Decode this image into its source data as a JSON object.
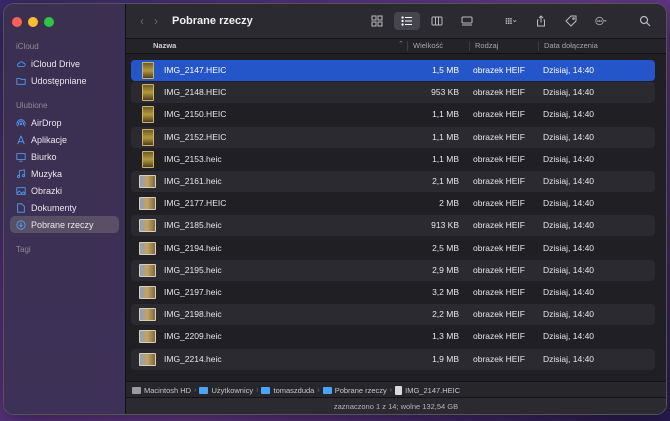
{
  "window": {
    "title": "Pobrane rzeczy"
  },
  "sidebar": {
    "sections": [
      {
        "title": "iCloud",
        "items": [
          {
            "label": "iCloud Drive",
            "icon": "cloud-icon"
          },
          {
            "label": "Udostępniane",
            "icon": "shared-folder-icon"
          }
        ]
      },
      {
        "title": "Ulubione",
        "items": [
          {
            "label": "AirDrop",
            "icon": "airdrop-icon"
          },
          {
            "label": "Aplikacje",
            "icon": "applications-icon"
          },
          {
            "label": "Biurko",
            "icon": "desktop-icon"
          },
          {
            "label": "Muzyka",
            "icon": "music-icon"
          },
          {
            "label": "Obrazki",
            "icon": "pictures-icon"
          },
          {
            "label": "Dokumenty",
            "icon": "documents-icon"
          },
          {
            "label": "Pobrane rzeczy",
            "icon": "downloads-icon",
            "selected": true
          }
        ]
      },
      {
        "title": "Tagi",
        "items": []
      }
    ]
  },
  "columns": {
    "name": "Nazwa",
    "size": "Wielkość",
    "kind": "Rodzaj",
    "date": "Data dołączenia"
  },
  "files": [
    {
      "name": "IMG_2147.HEIC",
      "size": "1,5 MB",
      "kind": "obrazek HEIF",
      "date": "Dzisiaj, 14:40",
      "orientation": "portrait",
      "selected": true
    },
    {
      "name": "IMG_2148.HEIC",
      "size": "953 KB",
      "kind": "obrazek HEIF",
      "date": "Dzisiaj, 14:40",
      "orientation": "portrait"
    },
    {
      "name": "IMG_2150.HEIC",
      "size": "1,1 MB",
      "kind": "obrazek HEIF",
      "date": "Dzisiaj, 14:40",
      "orientation": "portrait"
    },
    {
      "name": "IMG_2152.HEIC",
      "size": "1,1 MB",
      "kind": "obrazek HEIF",
      "date": "Dzisiaj, 14:40",
      "orientation": "portrait"
    },
    {
      "name": "IMG_2153.heic",
      "size": "1,1 MB",
      "kind": "obrazek HEIF",
      "date": "Dzisiaj, 14:40",
      "orientation": "portrait"
    },
    {
      "name": "IMG_2161.heic",
      "size": "2,1 MB",
      "kind": "obrazek HEIF",
      "date": "Dzisiaj, 14:40",
      "orientation": "landscape"
    },
    {
      "name": "IMG_2177.HEIC",
      "size": "2 MB",
      "kind": "obrazek HEIF",
      "date": "Dzisiaj, 14:40",
      "orientation": "landscape"
    },
    {
      "name": "IMG_2185.heic",
      "size": "913 KB",
      "kind": "obrazek HEIF",
      "date": "Dzisiaj, 14:40",
      "orientation": "landscape"
    },
    {
      "name": "IMG_2194.heic",
      "size": "2,5 MB",
      "kind": "obrazek HEIF",
      "date": "Dzisiaj, 14:40",
      "orientation": "landscape"
    },
    {
      "name": "IMG_2195.heic",
      "size": "2,9 MB",
      "kind": "obrazek HEIF",
      "date": "Dzisiaj, 14:40",
      "orientation": "landscape"
    },
    {
      "name": "IMG_2197.heic",
      "size": "3,2 MB",
      "kind": "obrazek HEIF",
      "date": "Dzisiaj, 14:40",
      "orientation": "landscape"
    },
    {
      "name": "IMG_2198.heic",
      "size": "2,2 MB",
      "kind": "obrazek HEIF",
      "date": "Dzisiaj, 14:40",
      "orientation": "landscape"
    },
    {
      "name": "IMG_2209.heic",
      "size": "1,3 MB",
      "kind": "obrazek HEIF",
      "date": "Dzisiaj, 14:40",
      "orientation": "landscape"
    },
    {
      "name": "IMG_2214.heic",
      "size": "1,9 MB",
      "kind": "obrazek HEIF",
      "date": "Dzisiaj, 14:40",
      "orientation": "landscape"
    }
  ],
  "pathbar": [
    {
      "label": "Macintosh HD",
      "icon": "disk-icon"
    },
    {
      "label": "Użytkownicy",
      "icon": "folder-icon"
    },
    {
      "label": "tomaszduda",
      "icon": "folder-icon"
    },
    {
      "label": "Pobrane rzeczy",
      "icon": "folder-icon"
    },
    {
      "label": "IMG_2147.HEIC",
      "icon": "file-icon"
    }
  ],
  "status": "zaznaczono 1 z 14; wolne 132,54 GB",
  "colors": {
    "selection": "#2456c9",
    "accent": "#4aa3ff",
    "sidebar": "#3b3050"
  }
}
